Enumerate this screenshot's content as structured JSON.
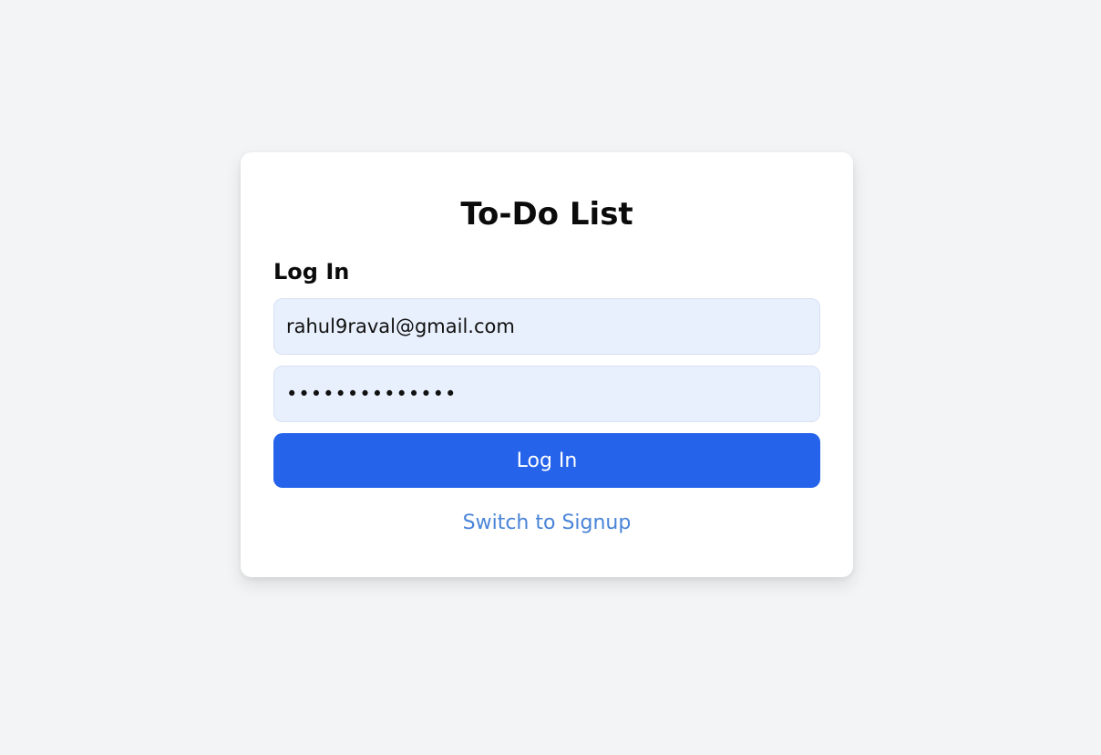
{
  "app": {
    "title": "To-Do List"
  },
  "login_form": {
    "heading": "Log In",
    "email_value": "rahul9raval@gmail.com",
    "password_value": "password123456",
    "submit_label": "Log In",
    "switch_label": "Switch to Signup"
  },
  "colors": {
    "page_background": "#f2f4f6",
    "card_background": "#ffffff",
    "input_background": "#e8f0fd",
    "primary": "#2563eb",
    "link": "#4a84d8"
  }
}
